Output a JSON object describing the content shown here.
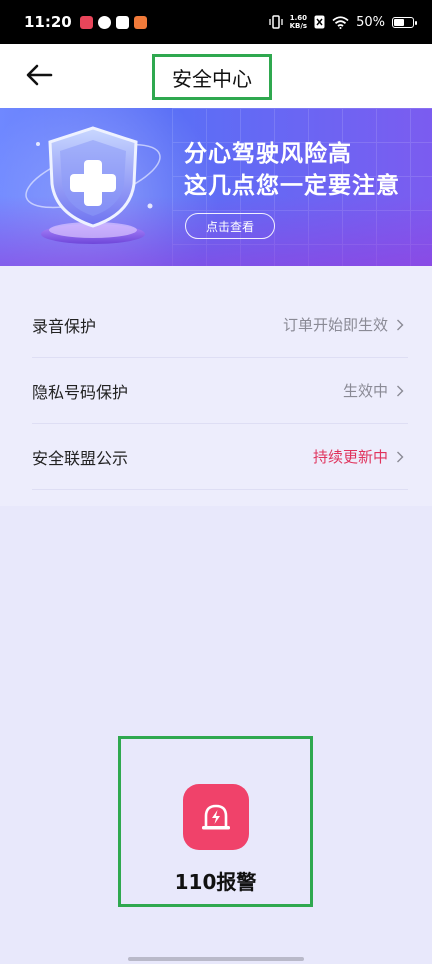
{
  "status_bar": {
    "time": "11:20",
    "network_speed_value": "1.60",
    "network_speed_unit": "KB/s",
    "battery": "50%",
    "app_icon_colors": [
      "#e8455a",
      "#ffffff",
      "#ffffff",
      "#f07a3a"
    ]
  },
  "header": {
    "title": "安全中心",
    "back_icon": "arrow-left-icon"
  },
  "banner": {
    "headline_line1": "分心驾驶风险高",
    "headline_line2": "这几点您一定要注意",
    "button_label": "点击查看"
  },
  "settings": {
    "items": [
      {
        "label": "录音保护",
        "value": "订单开始即生效"
      },
      {
        "label": "隐私号码保护",
        "value": "生效中"
      },
      {
        "label": "安全联盟公示",
        "value": "持续更新中"
      }
    ]
  },
  "emergency": {
    "label": "110报警",
    "icon": "alarm-siren-icon",
    "color": "#f0426a"
  },
  "colors": {
    "highlight_value": "#e0335c",
    "accent": "#5a6ff6"
  }
}
